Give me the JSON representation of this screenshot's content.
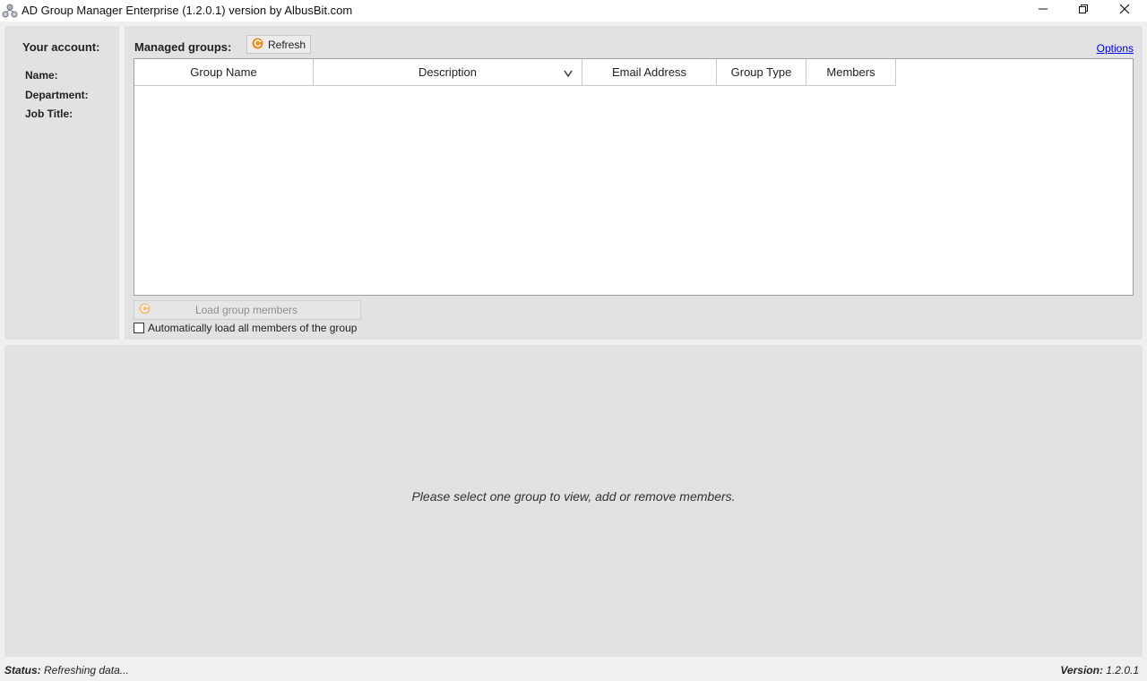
{
  "window": {
    "title": "AD Group Manager Enterprise (1.2.0.1) version by AlbusBit.com",
    "icon": "network-users-icon",
    "controls": [
      "minimize-icon",
      "restore-icon",
      "close-icon"
    ]
  },
  "account": {
    "title": "Your account:",
    "fields": {
      "name_label": "Name:",
      "department_label": "Department:",
      "job_title_label": "Job Title:"
    }
  },
  "groups": {
    "label": "Managed groups:",
    "refresh_label": "Refresh",
    "options_label": "Options",
    "columns": [
      "Group Name",
      "Description",
      "Email Address",
      "Group Type",
      "Members"
    ],
    "rows": [],
    "load_members_label": "Load group members",
    "auto_load_label": "Automatically load all members of the group",
    "auto_load_checked": false
  },
  "members": {
    "placeholder": "Please select one group to view, add or remove members."
  },
  "status": {
    "label": "Status:",
    "value": "Refreshing data...",
    "version_label": "Version:",
    "version_value": "1.2.0.1"
  },
  "colors": {
    "accent_orange": "#f28c1e",
    "link_blue": "#0000ee",
    "panel_gray": "#e2e2e4"
  }
}
